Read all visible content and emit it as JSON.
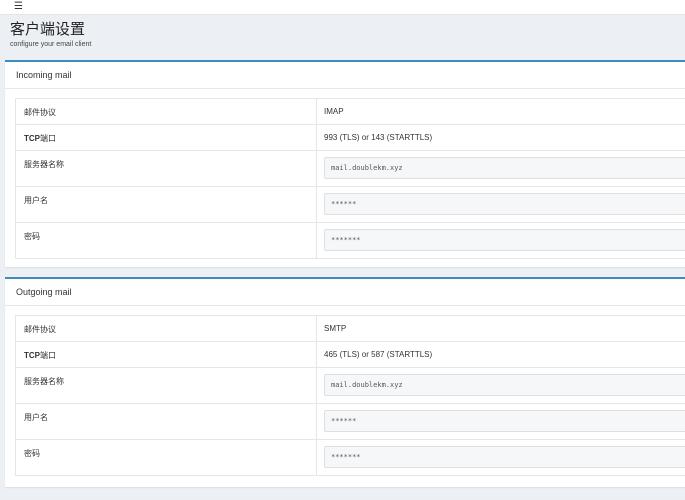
{
  "header": {
    "menu_icon": "hamburger-icon",
    "title": "客户端设置",
    "subtitle": "configure your email client"
  },
  "incoming": {
    "title": "Incoming mail",
    "rows": {
      "protocol_label": "邮件协议",
      "protocol_value": "IMAP",
      "port_label_prefix": "TCP",
      "port_label_suffix": "端口",
      "port_value": "993 (TLS) or 143 (STARTTLS)",
      "server_label": "服务器名称",
      "server_value": "mail.doublekm.xyz",
      "user_label": "用户名",
      "user_value": "******",
      "password_label": "密码",
      "password_value": "*******"
    }
  },
  "outgoing": {
    "title": "Outgoing mail",
    "rows": {
      "protocol_label": "邮件协议",
      "protocol_value": "SMTP",
      "port_label_prefix": "TCP",
      "port_label_suffix": "端口",
      "port_value": "465 (TLS) or 587 (STARTTLS)",
      "server_label": "服务器名称",
      "server_value": "mail.doublekm.xyz",
      "user_label": "用户名",
      "user_value": "******",
      "password_label": "密码",
      "password_value": "*******"
    }
  },
  "colors": {
    "accent": "#3c8dbc",
    "background": "#ecf0f5"
  }
}
